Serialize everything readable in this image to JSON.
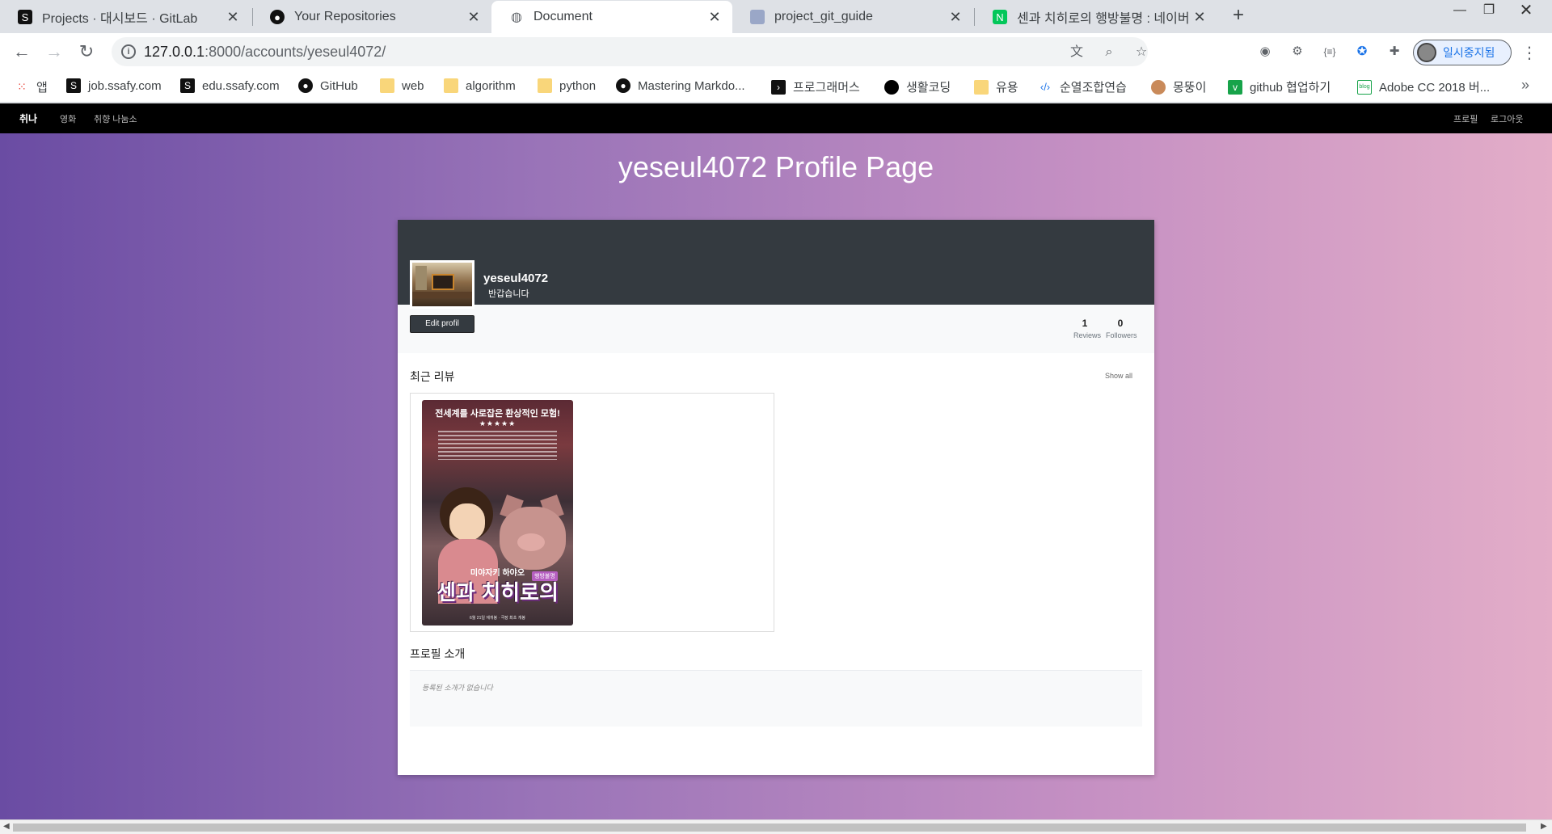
{
  "tabs": [
    {
      "title": "Projects · 대시보드 · GitLab",
      "icon": "gitlab-icon",
      "active": false
    },
    {
      "title": "Your Repositories",
      "icon": "github-icon",
      "active": false
    },
    {
      "title": "Document",
      "icon": "globe-icon",
      "active": true
    },
    {
      "title": "project_git_guide",
      "icon": "doc-icon",
      "active": false
    },
    {
      "title": "센과 치히로의 행방불명 : 네이버",
      "icon": "naver-icon",
      "active": false
    }
  ],
  "address": {
    "host": "127.0.0.1",
    "path": ":8000/accounts/yeseul4072/"
  },
  "profile_label": "일시중지됨",
  "bookmarks": [
    {
      "label": "앱",
      "icon": "apps-grid-icon"
    },
    {
      "label": "job.ssafy.com",
      "icon": "ssafy-icon"
    },
    {
      "label": "edu.ssafy.com",
      "icon": "ssafy-icon"
    },
    {
      "label": "GitHub",
      "icon": "github-icon"
    },
    {
      "label": "web",
      "icon": "folder-icon"
    },
    {
      "label": "algorithm",
      "icon": "folder-icon"
    },
    {
      "label": "python",
      "icon": "folder-icon"
    },
    {
      "label": "Mastering Markdo...",
      "icon": "github-icon"
    },
    {
      "label": "프로그래머스",
      "icon": "programmers-icon"
    },
    {
      "label": "생활코딩",
      "icon": "dot-icon"
    },
    {
      "label": "유용",
      "icon": "folder-icon"
    },
    {
      "label": "순열조합연습",
      "icon": "code-icon"
    },
    {
      "label": "몽뚱이",
      "icon": "dog-icon"
    },
    {
      "label": "github 협업하기",
      "icon": "velog-icon"
    },
    {
      "label": "Adobe CC 2018 버...",
      "icon": "blog-icon"
    }
  ],
  "site_nav": {
    "brand": "취나",
    "links": [
      "영화",
      "취향 나눔소"
    ],
    "right_links": [
      "프로필",
      "로그아웃"
    ]
  },
  "page": {
    "heading": "yeseul4072 Profile Page",
    "username": "yeseul4072",
    "greeting": "반갑습니다",
    "edit_button": "Edit profil",
    "stats": [
      {
        "value": "1",
        "label": "Reviews"
      },
      {
        "value": "0",
        "label": "Followers"
      }
    ],
    "recent_reviews_title": "최근 리뷰",
    "show_all": "Show all",
    "poster": {
      "tagline": "전세계를 사로잡은 환상적인 모험!",
      "stars": "★★★★★",
      "director_line": "미야자키 하야오",
      "title_text": "센과 치히로의",
      "badge": "행방불명",
      "footer": "6월 21일 재개봉 · 극장 최초 개봉"
    },
    "intro_title": "프로필 소개",
    "intro_text": "등록된 소개가 없습니다"
  }
}
